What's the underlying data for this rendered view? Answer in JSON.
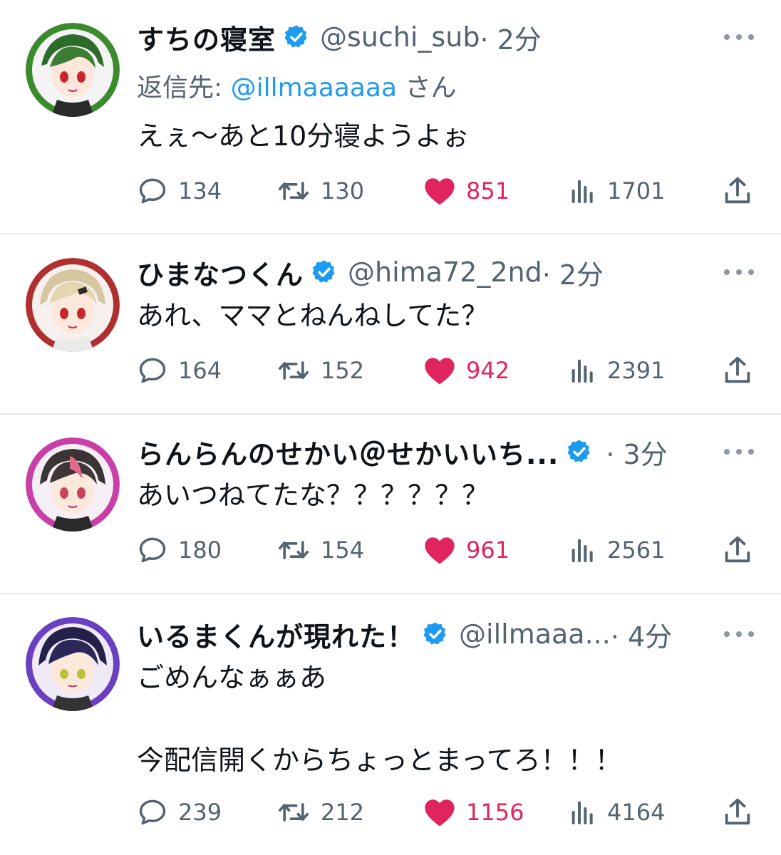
{
  "colors": {
    "like": "#e0245e",
    "verified": "#1d9bf0",
    "secondary": "#536471",
    "link": "#1d9bf0"
  },
  "icons": {
    "reply": "speech-bubble-icon",
    "retweet": "retweet-arrows-icon",
    "like": "heart-icon",
    "views": "bar-chart-icon",
    "share": "share-upload-icon",
    "more": "ellipsis-icon",
    "verified": "verified-badge-icon"
  },
  "tweets": [
    {
      "name": "すちの寝室",
      "handle": "@suchi_sub",
      "time": "· 2分",
      "reply_prefix": "返信先: ",
      "reply_handle": "@illmaaaaaa",
      "reply_suffix": " さん",
      "text": "えぇ〜あと10分寝ようよぉ",
      "stats": {
        "replies": "134",
        "retweets": "130",
        "likes": "851",
        "views": "1701"
      }
    },
    {
      "name": "ひまなつくん",
      "handle": "@hima72_2nd",
      "time": "· 2分",
      "text": "あれ、ママとねんねしてた？",
      "stats": {
        "replies": "164",
        "retweets": "152",
        "likes": "942",
        "views": "2391"
      }
    },
    {
      "name": "らんらんのせかい＠せかいいち...",
      "handle": "",
      "time": "· 3分",
      "text": "あいつねてたな？？？？？？",
      "stats": {
        "replies": "180",
        "retweets": "154",
        "likes": "961",
        "views": "2561"
      }
    },
    {
      "name": "いるまくんが現れた！",
      "handle": "@illmaaa...",
      "time": "· 4分",
      "text": "ごめんなぁぁあ\n\n今配信開くからちょっとまってろ！！！",
      "stats": {
        "replies": "239",
        "retweets": "212",
        "likes": "1156",
        "views": "4164"
      }
    }
  ]
}
